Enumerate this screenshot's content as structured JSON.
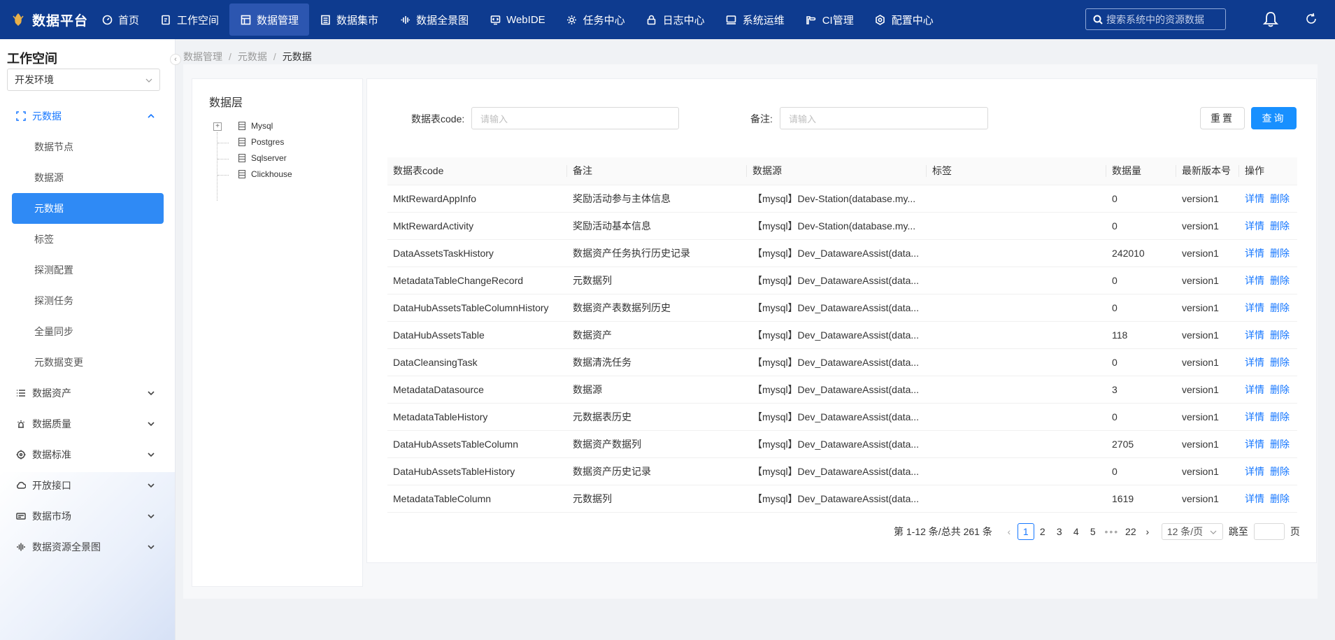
{
  "brand": {
    "name": "数据平台"
  },
  "nav": [
    {
      "label": "首页",
      "icon": "dashboard-icon"
    },
    {
      "label": "工作空间",
      "icon": "edit-icon"
    },
    {
      "label": "数据管理",
      "icon": "table-icon",
      "active": true
    },
    {
      "label": "数据集市",
      "icon": "list-icon"
    },
    {
      "label": "数据全景图",
      "icon": "graph-icon"
    },
    {
      "label": "WebIDE",
      "icon": "code-icon"
    },
    {
      "label": "任务中心",
      "icon": "gear-icon"
    },
    {
      "label": "日志中心",
      "icon": "lock-icon"
    },
    {
      "label": "系统运维",
      "icon": "monitor-icon"
    },
    {
      "label": "CI管理",
      "icon": "wrench-icon"
    },
    {
      "label": "配置中心",
      "icon": "settings-icon"
    }
  ],
  "search": {
    "placeholder": "搜索系统中的资源数据"
  },
  "sidebar": {
    "title": "工作空间",
    "env": "开发环境",
    "metadata_group": "元数据",
    "sub_items": [
      "数据节点",
      "数据源",
      "元数据",
      "标签",
      "探测配置",
      "探测任务",
      "全量同步",
      "元数据变更"
    ],
    "active_sub": "元数据",
    "groups": [
      "数据资产",
      "数据质量",
      "数据标准",
      "开放接口",
      "数据市场",
      "数据资源全景图"
    ]
  },
  "breadcrumb": [
    "数据管理",
    "元数据",
    "元数据"
  ],
  "tree": {
    "title": "数据层",
    "nodes": [
      "Mysql",
      "Postgres",
      "Sqlserver",
      "Clickhouse"
    ]
  },
  "filters": {
    "code_label": "数据表code:",
    "code_placeholder": "请输入",
    "remark_label": "备注:",
    "remark_placeholder": "请输入",
    "reset": "重置",
    "query": "查询"
  },
  "table": {
    "headers": [
      "数据表code",
      "备注",
      "数据源",
      "标签",
      "数据量",
      "最新版本号",
      "操作"
    ],
    "detail_label": "详情",
    "delete_label": "删除",
    "rows": [
      [
        "MktRewardAppInfo",
        "奖励活动参与主体信息",
        "【mysql】Dev-Station(database.my...",
        "",
        "0",
        "version1"
      ],
      [
        "MktRewardActivity",
        "奖励活动基本信息",
        "【mysql】Dev-Station(database.my...",
        "",
        "0",
        "version1"
      ],
      [
        "DataAssetsTaskHistory",
        "数据资产任务执行历史记录",
        "【mysql】Dev_DatawareAssist(data...",
        "",
        "242010",
        "version1"
      ],
      [
        "MetadataTableChangeRecord",
        "元数据列",
        "【mysql】Dev_DatawareAssist(data...",
        "",
        "0",
        "version1"
      ],
      [
        "DataHubAssetsTableColumnHistory",
        "数据资产表数据列历史",
        "【mysql】Dev_DatawareAssist(data...",
        "",
        "0",
        "version1"
      ],
      [
        "DataHubAssetsTable",
        "数据资产",
        "【mysql】Dev_DatawareAssist(data...",
        "",
        "118",
        "version1"
      ],
      [
        "DataCleansingTask",
        "数据清洗任务",
        "【mysql】Dev_DatawareAssist(data...",
        "",
        "0",
        "version1"
      ],
      [
        "MetadataDatasource",
        "数据源",
        "【mysql】Dev_DatawareAssist(data...",
        "",
        "3",
        "version1"
      ],
      [
        "MetadataTableHistory",
        "元数据表历史",
        "【mysql】Dev_DatawareAssist(data...",
        "",
        "0",
        "version1"
      ],
      [
        "DataHubAssetsTableColumn",
        "数据资产数据列",
        "【mysql】Dev_DatawareAssist(data...",
        "",
        "2705",
        "version1"
      ],
      [
        "DataHubAssetsTableHistory",
        "数据资产历史记录",
        "【mysql】Dev_DatawareAssist(data...",
        "",
        "0",
        "version1"
      ],
      [
        "MetadataTableColumn",
        "元数据列",
        "【mysql】Dev_DatawareAssist(data...",
        "",
        "1619",
        "version1"
      ]
    ]
  },
  "pagination": {
    "summary": "第 1-12 条/总共 261 条",
    "pages": [
      "1",
      "2",
      "3",
      "4",
      "5"
    ],
    "ellipsis": "•••",
    "last": "22",
    "current": "1",
    "page_size": "12 条/页",
    "jump_label": "跳至",
    "page_unit": "页"
  },
  "colors": {
    "nav_bg": "#0e3b8f",
    "accent": "#1677ff",
    "sidebar_active": "#2f8af5"
  }
}
